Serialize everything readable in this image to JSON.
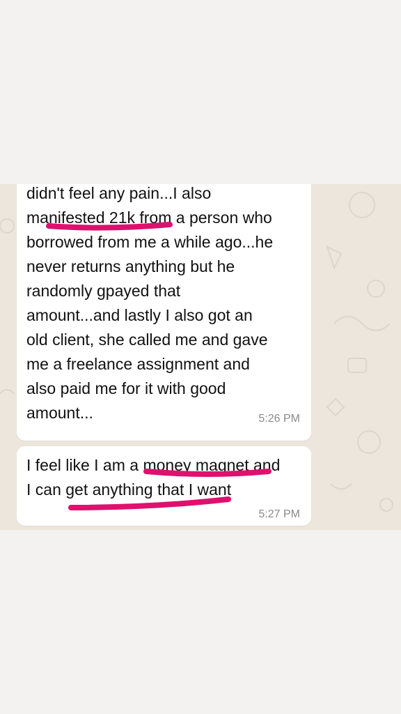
{
  "messages": [
    {
      "lines": [
        "didn't feel any pain...I also",
        "manifested 21k from a person who",
        "borrowed from me a while ago...he",
        "never returns anything but he",
        "randomly gpayed that",
        "amount...and lastly I also got an",
        "old client, she called me and gave",
        "me a freelance assignment and",
        "also paid me for it with good",
        "amount..."
      ],
      "time": "5:26 PM"
    },
    {
      "lines": [
        "I feel like I am a money magnet and",
        "I can get anything that I want"
      ],
      "time": "5:27 PM"
    }
  ],
  "colors": {
    "page_background": "#f3f2f0",
    "chat_wallpaper": "#ece6dd",
    "bubble": "#ffffff",
    "highlight_marker": "#e0106f"
  },
  "icons": [
    "doodle-wallpaper-pattern"
  ]
}
